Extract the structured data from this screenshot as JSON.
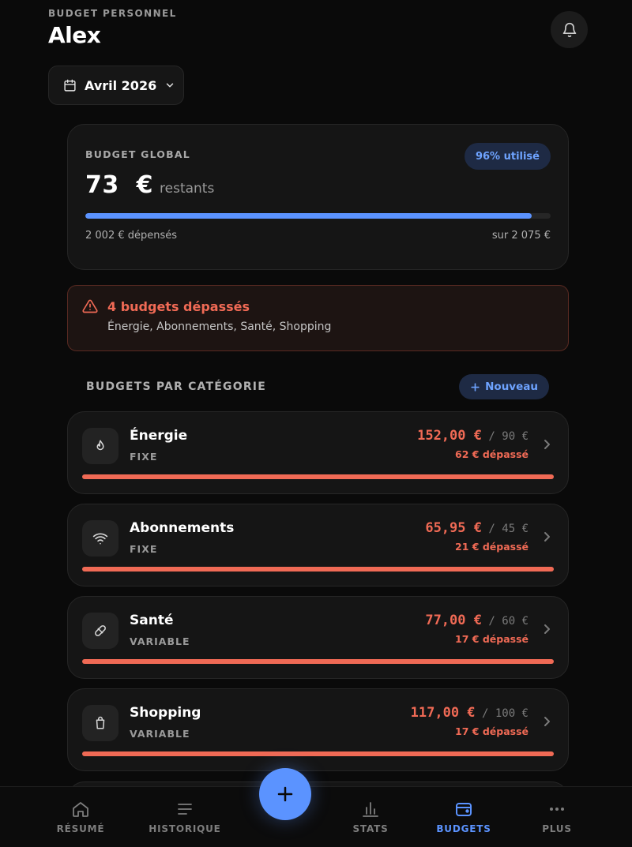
{
  "header": {
    "eyebrow": "BUDGET PERSONNEL",
    "name": "Alex"
  },
  "month_selector": {
    "label": "Avril 2026",
    "icon": "calendar-icon"
  },
  "global_budget": {
    "label": "BUDGET GLOBAL",
    "usage_badge": "96% utilisé",
    "remaining_amount": "73  €",
    "remaining_suffix": "restants",
    "spent_text": "2 002 € dépensés",
    "total_text": "sur 2 075 €",
    "progress": 0.96,
    "accent": "#5b93ff"
  },
  "alert": {
    "title": "4 budgets dépassés",
    "detail": "Énergie, Abonnements, Santé, Shopping",
    "color": "#f06a55"
  },
  "section": {
    "title": "BUDGETS PAR CATÉGORIE",
    "new_button": "Nouveau"
  },
  "categories": [
    {
      "name": "Énergie",
      "type": "FIXE",
      "spent": "152,00 €",
      "limit": "90 €",
      "over": "62 € dépassé",
      "icon": "flame-icon",
      "progress": 1.0
    },
    {
      "name": "Abonnements",
      "type": "FIXE",
      "spent": "65,95 €",
      "limit": "45 €",
      "over": "21 € dépassé",
      "icon": "wifi-icon",
      "progress": 1.0
    },
    {
      "name": "Santé",
      "type": "VARIABLE",
      "spent": "77,00 €",
      "limit": "60 €",
      "over": "17 € dépassé",
      "icon": "pill-icon",
      "progress": 1.0
    },
    {
      "name": "Shopping",
      "type": "VARIABLE",
      "spent": "117,00 €",
      "limit": "100 €",
      "over": "17 € dépassé",
      "icon": "bag-icon",
      "progress": 1.0
    }
  ],
  "nav": {
    "items": [
      {
        "label": "RÉSUMÉ",
        "icon": "home-icon",
        "active": false
      },
      {
        "label": "HISTORIQUE",
        "icon": "list-icon",
        "active": false
      },
      {
        "label": "STATS",
        "icon": "bar-chart-icon",
        "active": false
      },
      {
        "label": "BUDGETS",
        "icon": "wallet-icon",
        "active": true
      },
      {
        "label": "PLUS",
        "icon": "more-icon",
        "active": false
      }
    ],
    "fab_icon": "plus-icon"
  }
}
